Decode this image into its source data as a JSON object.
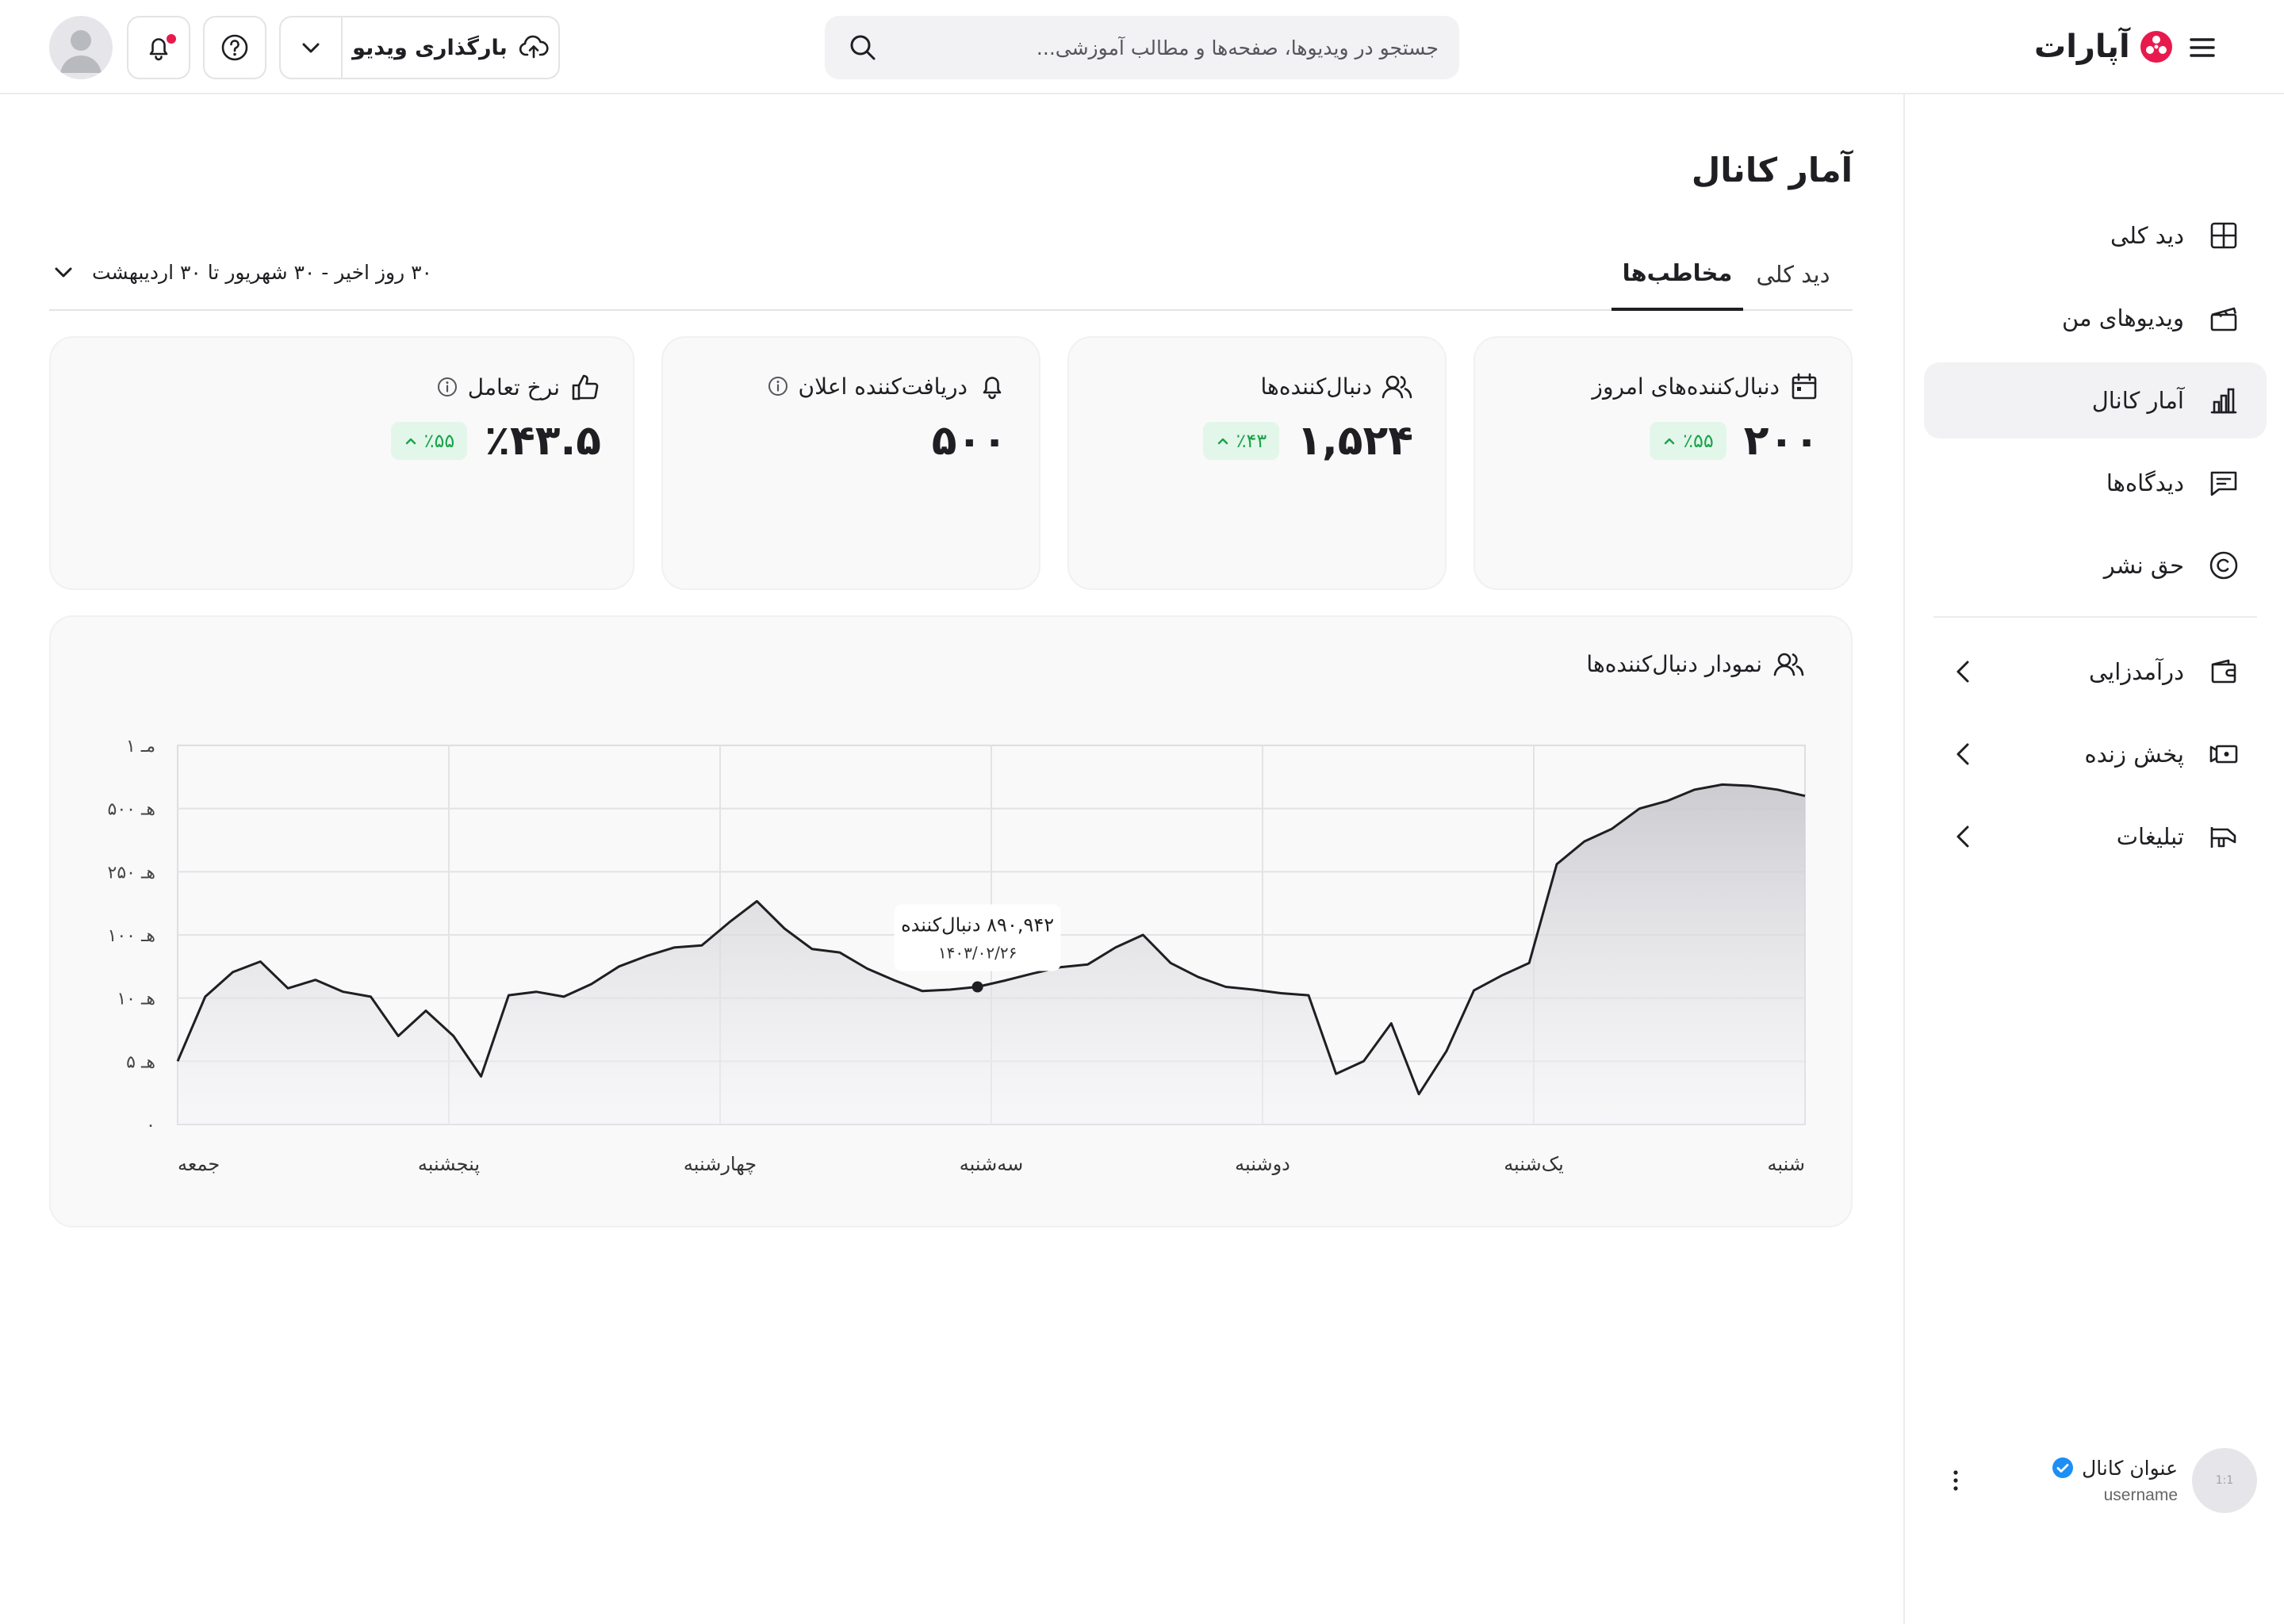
{
  "header": {
    "logo_text": "آپارات",
    "search_placeholder": "جستجو در ویدیوها، صفحه‌ها و مطالب آموزشی...",
    "upload_label": "بارگذاری ویدیو"
  },
  "sidebar": {
    "items": [
      {
        "label": "دید کلی",
        "icon": "grid-icon"
      },
      {
        "label": "ویدیوهای من",
        "icon": "clapperboard-icon"
      },
      {
        "label": "آمار کانال",
        "icon": "bar-chart-icon",
        "active": true
      },
      {
        "label": "دیدگاه‌ها",
        "icon": "comment-icon"
      },
      {
        "label": "حق نشر",
        "icon": "copyright-icon"
      },
      {
        "label": "درآمدزایی",
        "icon": "wallet-icon",
        "expandable": true
      },
      {
        "label": "پخش زنده",
        "icon": "live-camera-icon",
        "expandable": true
      },
      {
        "label": "تبلیغات",
        "icon": "megaphone-icon",
        "expandable": true
      }
    ],
    "channel": {
      "title": "عنوان کانال",
      "username": "username",
      "avatar_text": "1:1"
    }
  },
  "main": {
    "page_title": "آمار کانال",
    "tabs": [
      {
        "label": "دید کلی",
        "active": false
      },
      {
        "label": "مخاطب‌ها",
        "active": true
      }
    ],
    "date_range": "۳۰ روز اخیر - ۳۰ شهریور تا ۳۰ اردیبهشت",
    "stats": [
      {
        "title": "دنبال‌کننده‌های امروز",
        "value": "۲۰۰",
        "badge": "٪۵۵",
        "icon": "calendar-icon"
      },
      {
        "title": "دنبال‌کننده‌ها",
        "value": "۱,۵۲۴",
        "badge": "٪۴۳",
        "icon": "users-icon"
      },
      {
        "title": "دریافت‌کننده اعلان",
        "value": "۵۰۰",
        "icon": "bell-icon",
        "info": true
      },
      {
        "title": "نرخ تعامل",
        "value": "٪۴۳.۵",
        "badge": "٪۵۵",
        "icon": "thumbs-up-icon",
        "info": true
      }
    ],
    "chart_title": "نمودار دنبال‌کننده‌ها"
  },
  "colors": {
    "accent": "#1f1f23",
    "brand": "#e8194c",
    "positive": "#19a34a",
    "positive_bg": "#e3f6ea"
  },
  "chart_data": {
    "type": "area",
    "title": "نمودار دنبال‌کننده‌ها",
    "y_scale": "nonlinear",
    "y_ticks": [
      "۰",
      "۵ هـ",
      "۱۰ هـ",
      "۱۰۰ هـ",
      "۲۵۰ هـ",
      "۵۰۰ هـ",
      "۱ مـ"
    ],
    "y_tick_values": [
      0,
      5000,
      10000,
      100000,
      250000,
      500000,
      1000000
    ],
    "x_ticks": [
      "شنبه",
      "یک‌شنبه",
      "دوشنبه",
      "سه‌شنبه",
      "چهارشنبه",
      "پنجشنبه",
      "جمعه"
    ],
    "x_direction": "right-to-left",
    "grid": true,
    "series": [
      {
        "values": [
          600000,
          650000,
          680000,
          690000,
          650000,
          560000,
          500000,
          420000,
          370000,
          280000,
          60000,
          42000,
          21000,
          5800,
          2400,
          8000,
          5000,
          4000,
          14000,
          17000,
          22000,
          26000,
          40000,
          60000,
          100000,
          82000,
          58000,
          54000,
          45000,
          35000,
          26000,
          22000,
          20000,
          35000,
          52000,
          75000,
          80000,
          115000,
          180000,
          130000,
          85000,
          82000,
          70000,
          55000,
          30000,
          12000,
          19000,
          14000,
          3800,
          7000,
          9000,
          7000,
          12000,
          19000,
          36000,
          24000,
          62000,
          47000,
          12000,
          5000
        ]
      }
    ],
    "tooltip": {
      "value_text": "۸۹۰,۹۴۲ دنبال‌کننده",
      "date_text": "۱۴۰۳/۰۲/۲۶",
      "point_index": 30
    }
  }
}
